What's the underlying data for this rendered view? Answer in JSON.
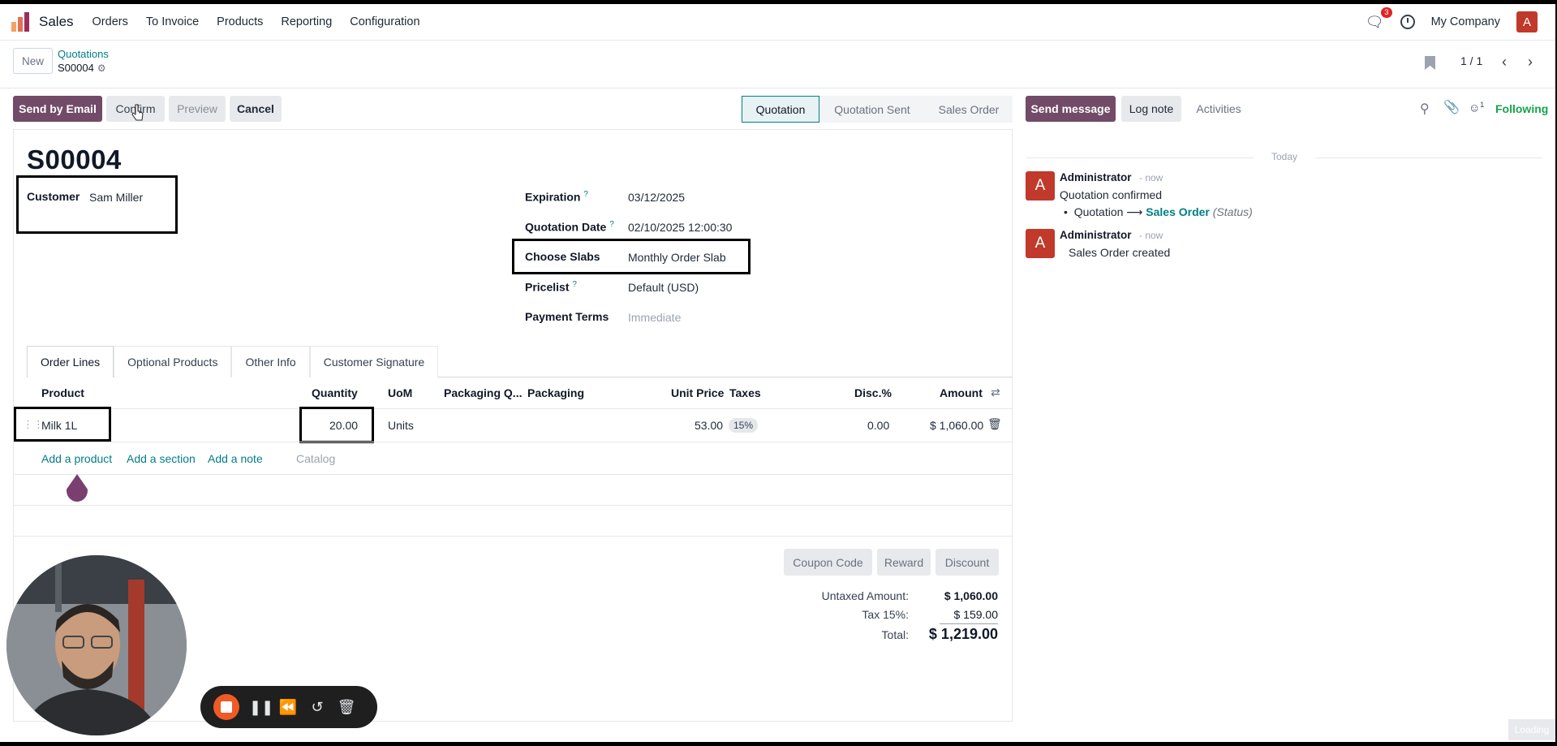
{
  "navbar": {
    "app_name": "Sales",
    "menu": [
      "Orders",
      "To Invoice",
      "Products",
      "Reporting",
      "Configuration"
    ],
    "chat_count": "3",
    "company": "My Company",
    "avatar_letter": "A"
  },
  "control_panel": {
    "new_label": "New",
    "breadcrumb_parent": "Quotations",
    "breadcrumb_current": "S00004",
    "pager": "1 / 1"
  },
  "actions": {
    "send_email": "Send by Email",
    "confirm": "Confirm",
    "preview": "Preview",
    "cancel": "Cancel"
  },
  "status_stages": [
    "Quotation",
    "Quotation Sent",
    "Sales Order"
  ],
  "status_active": "Quotation",
  "chatter_actions": {
    "send_message": "Send message",
    "log_note": "Log note",
    "activities": "Activities",
    "followers_count": "1",
    "following": "Following"
  },
  "record": {
    "name": "S00004",
    "customer_label": "Customer",
    "customer": "Sam Miller",
    "expiration_label": "Expiration",
    "expiration": "03/12/2025",
    "quotation_date_label": "Quotation Date",
    "quotation_date": "02/10/2025 12:00:30",
    "slabs_label": "Choose Slabs",
    "slabs": "Monthly Order Slab",
    "pricelist_label": "Pricelist",
    "pricelist": "Default (USD)",
    "payment_terms_label": "Payment Terms",
    "payment_terms": "Immediate"
  },
  "tabs": [
    "Order Lines",
    "Optional Products",
    "Other Info",
    "Customer Signature"
  ],
  "table": {
    "headers": {
      "product": "Product",
      "quantity": "Quantity",
      "uom": "UoM",
      "packaging_qty": "Packaging Q...",
      "packaging": "Packaging",
      "unit_price": "Unit Price",
      "taxes": "Taxes",
      "disc": "Disc.%",
      "amount": "Amount"
    },
    "rows": [
      {
        "product": "Milk 1L",
        "quantity": "20.00",
        "uom": "Units",
        "unit_price": "53.00",
        "taxes": "15%",
        "disc": "0.00",
        "amount": "$ 1,060.00"
      }
    ],
    "add_product": "Add a product",
    "add_section": "Add a section",
    "add_note": "Add a note",
    "catalog": "Catalog"
  },
  "buttons": {
    "coupon": "Coupon Code",
    "reward": "Reward",
    "discount": "Discount"
  },
  "totals": {
    "untaxed_label": "Untaxed Amount:",
    "untaxed": "$ 1,060.00",
    "tax_label": "Tax 15%:",
    "tax": "$ 159.00",
    "total_label": "Total:",
    "total": "$ 1,219.00"
  },
  "chatter": {
    "date_separator": "Today",
    "messages": [
      {
        "author": "Administrator",
        "time": "- now",
        "body": "Quotation confirmed",
        "change_from": "Quotation",
        "change_to": "Sales Order",
        "change_field": "(Status)"
      },
      {
        "author": "Administrator",
        "time": "- now",
        "body": "Sales Order created"
      }
    ]
  },
  "overlay": {
    "loading": "Loading"
  },
  "colors": {
    "brand": "#714b67",
    "accent": "#017e84",
    "avatar": "#c0392b",
    "badge": "#e02424",
    "record_button": "#f05a24"
  }
}
